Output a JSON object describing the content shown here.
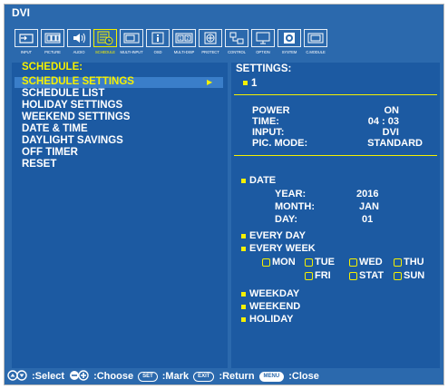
{
  "window": {
    "title": "DVI"
  },
  "toolbar": [
    {
      "id": "input",
      "label": "INPUT",
      "icon": "input-icon"
    },
    {
      "id": "picture",
      "label": "PICTURE",
      "icon": "picture-icon"
    },
    {
      "id": "audio",
      "label": "AUDIO",
      "icon": "speaker-icon"
    },
    {
      "id": "schedule",
      "label": "SCHEDULE",
      "icon": "schedule-icon",
      "active": true
    },
    {
      "id": "multiinput",
      "label": "MULTI-INPUT",
      "icon": "multi-input-icon"
    },
    {
      "id": "osd",
      "label": "OSD",
      "icon": "info-icon"
    },
    {
      "id": "multidisp",
      "label": "MULTI-DISP",
      "icon": "multi-display-icon"
    },
    {
      "id": "protect",
      "label": "PROTECT",
      "icon": "shield-icon"
    },
    {
      "id": "control",
      "label": "CONTROL",
      "icon": "control-icon"
    },
    {
      "id": "option",
      "label": "OPTION",
      "icon": "monitor-icon"
    },
    {
      "id": "system",
      "label": "SYSTEM",
      "icon": "gear-icon"
    },
    {
      "id": "cmodule",
      "label": "C.MODULE",
      "icon": "module-icon"
    }
  ],
  "menu": {
    "heading": "SCHEDULE:",
    "items": [
      "SCHEDULE SETTINGS",
      "SCHEDULE LIST",
      "HOLIDAY SETTINGS",
      "WEEKEND SETTINGS",
      "DATE & TIME",
      "DAYLIGHT SAVINGS",
      "OFF TIMER",
      "RESET"
    ]
  },
  "settings": {
    "heading": "SETTINGS:",
    "number": "1",
    "power": {
      "label": "POWER",
      "value": "ON"
    },
    "time": {
      "label": "TIME:",
      "value": "04 : 03"
    },
    "input": {
      "label": "INPUT:",
      "value": "DVI"
    },
    "picmode": {
      "label": "PIC. MODE:",
      "value": "STANDARD"
    },
    "date": {
      "label": "DATE",
      "year_label": "YEAR:",
      "year": "2016",
      "month_label": "MONTH:",
      "month": "JAN",
      "day_label": "DAY:",
      "day": "01"
    },
    "every_day": "EVERY DAY",
    "every_week": "EVERY WEEK",
    "days": [
      "MON",
      "TUE",
      "WED",
      "THU",
      "FRI",
      "STAT",
      "SUN"
    ],
    "weekday": "WEEKDAY",
    "weekend": "WEEKEND",
    "holiday": "HOLIDAY"
  },
  "footer": {
    "select": ":Select",
    "choose": ":Choose",
    "set_btn": "SET",
    "mark": ":Mark",
    "exit_btn": "EXIT",
    "return": ":Return",
    "menu_btn": "MENU",
    "close": ":Close"
  }
}
